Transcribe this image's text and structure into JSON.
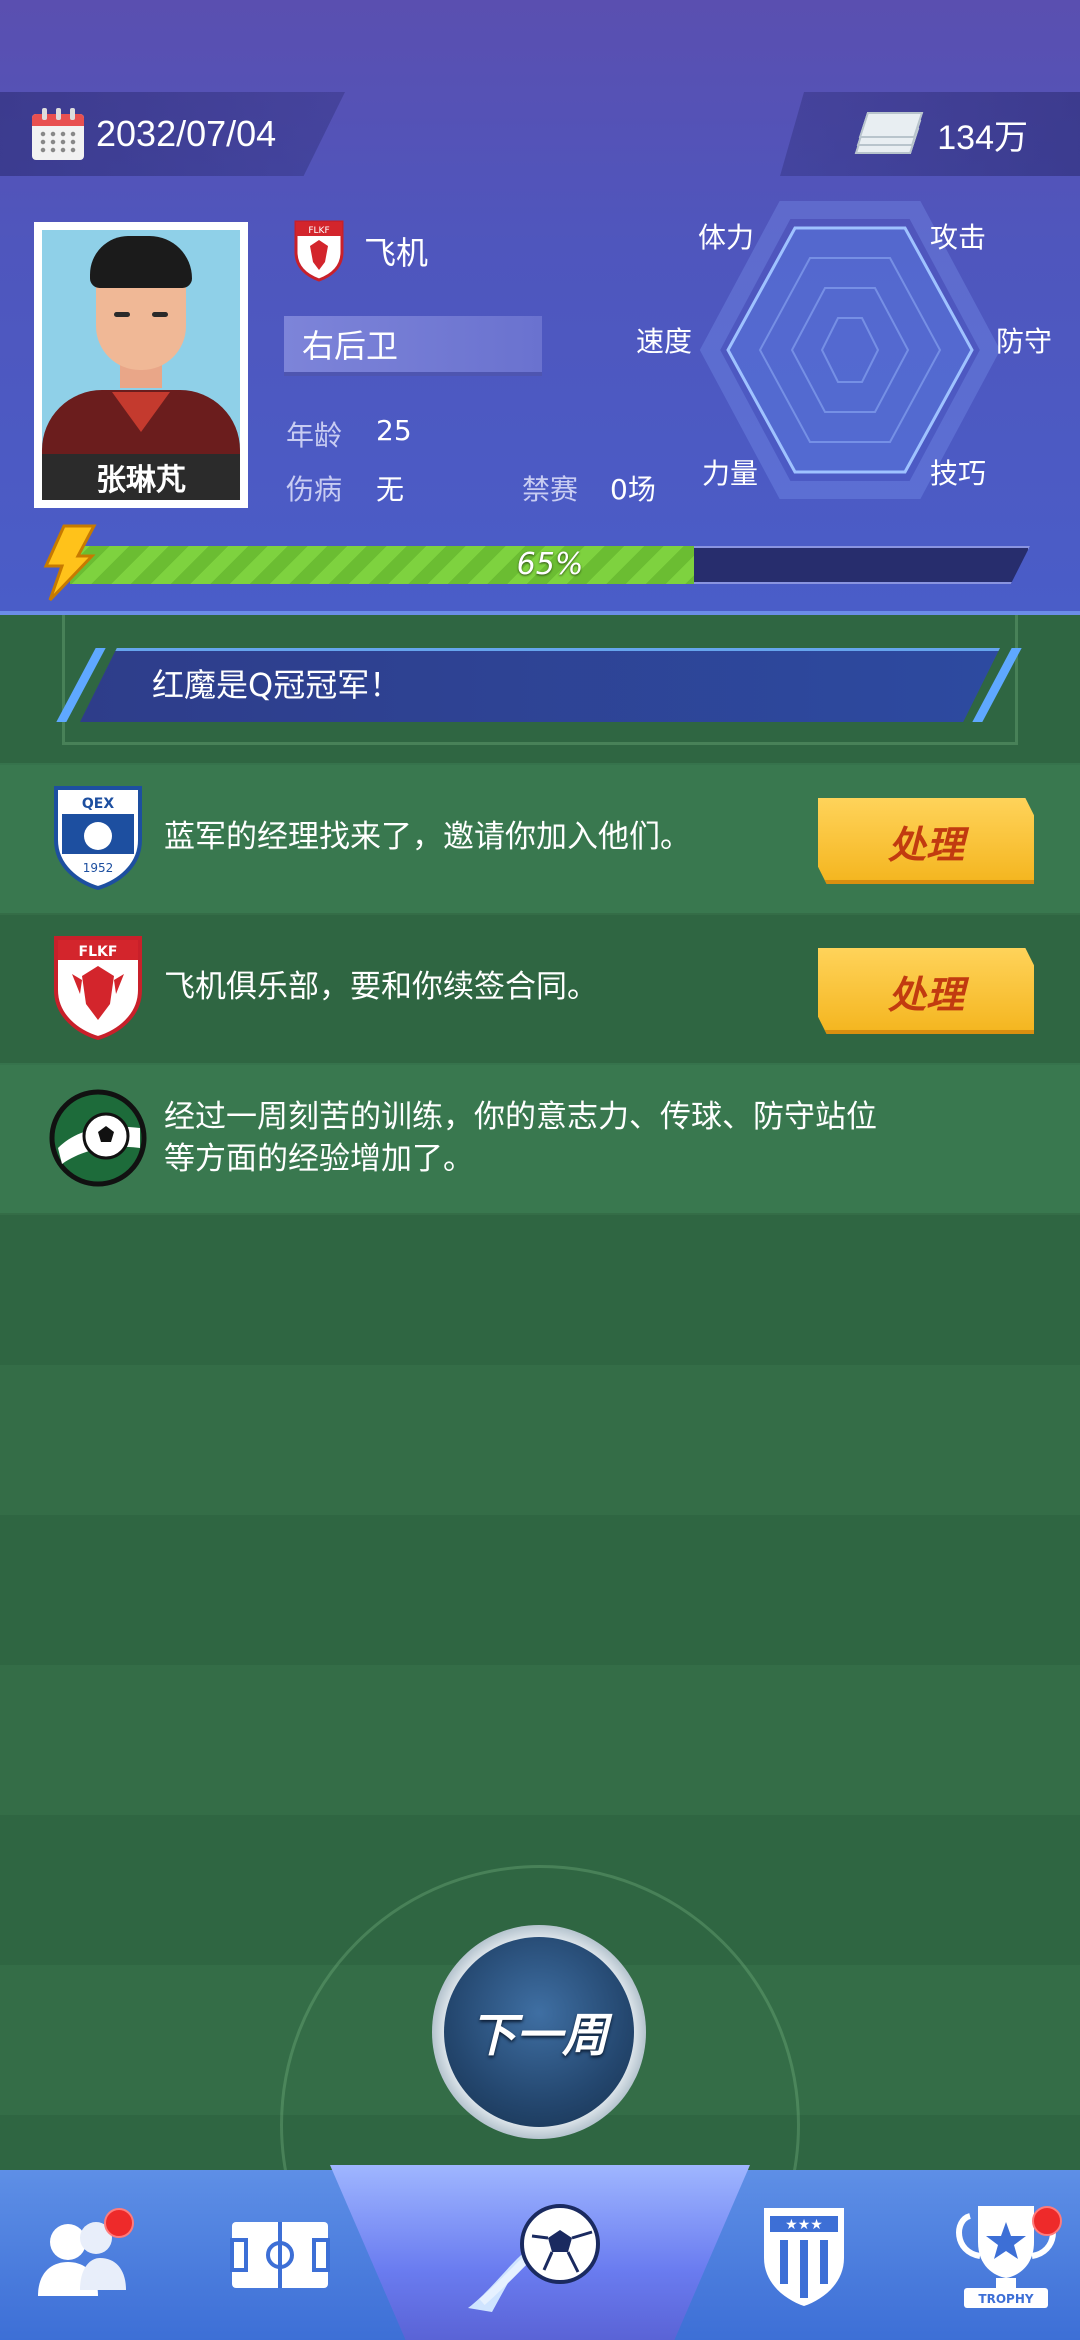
{
  "header": {
    "date": "2032/07/04",
    "money": "134万"
  },
  "player": {
    "name": "张琳芃",
    "club": "飞机",
    "position": "右后卫",
    "age_label": "年龄",
    "age": "25",
    "injury_label": "伤病",
    "injury": "无",
    "ban_label": "禁赛",
    "ban": "0场",
    "energy": "65%",
    "energy_fraction": 0.65
  },
  "radar": {
    "labels": {
      "stamina": "体力",
      "attack": "攻击",
      "speed": "速度",
      "defense": "防守",
      "strength": "力量",
      "skill": "技巧"
    }
  },
  "news": {
    "banner": "红魔是Q冠冠军！",
    "items": [
      {
        "text": "蓝军的经理找来了，邀请你加入他们。",
        "button": "处理",
        "icon": "qex-club-badge"
      },
      {
        "text": "飞机俱乐部，要和你续签合同。",
        "button": "处理",
        "icon": "flkf-club-badge"
      },
      {
        "text_line1": "经过一周刻苦的训练，你的意志力、传球、防守站位",
        "text_line2": "等方面的经验增加了。",
        "icon": "soccer-ball-icon"
      }
    ]
  },
  "badges": {
    "qex_top": "QEX",
    "qex_year": "1952",
    "flkf_top": "FLKF"
  },
  "next_week_label": "下一周",
  "nav": {
    "trophy_text": "TROPHY"
  },
  "colors": {
    "header_bg": "#4f56bd",
    "field_bg": "#2f6642",
    "handle_button": "#f4b51e",
    "energy_fill": "#7ed23f",
    "notification_dot": "#ee2a2a"
  }
}
